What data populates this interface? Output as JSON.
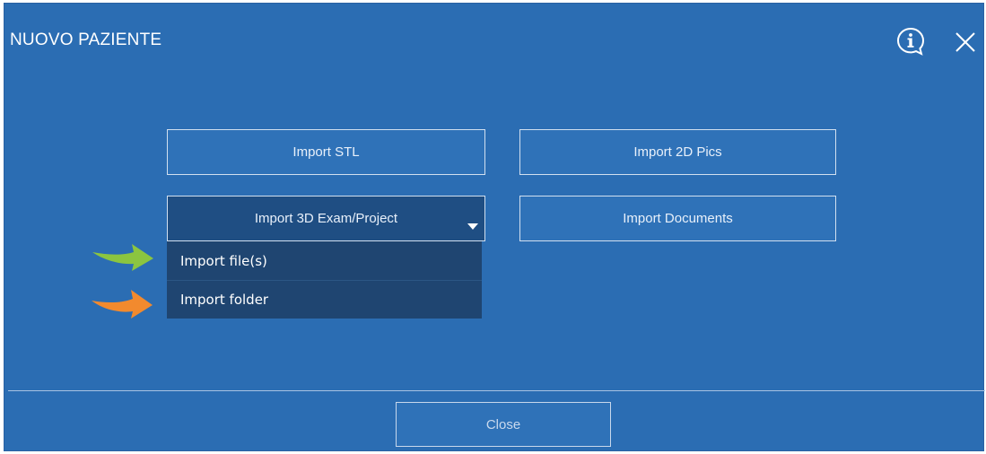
{
  "dialog": {
    "title": "NUOVO PAZIENTE",
    "background": "#2b6db3"
  },
  "header": {
    "info_icon": "info-circle-icon",
    "close_icon": "close-icon"
  },
  "buttons": {
    "import_stl": "Import STL",
    "import_2d_pics": "Import 2D Pics",
    "import_3d_exam": "Import 3D Exam/Project",
    "import_documents": "Import Documents"
  },
  "dropdown": {
    "items": [
      "Import file(s)",
      "Import folder"
    ],
    "arrow_colors": [
      "#8bc540",
      "#f28a2e"
    ]
  },
  "footer": {
    "close_label": "Close"
  }
}
